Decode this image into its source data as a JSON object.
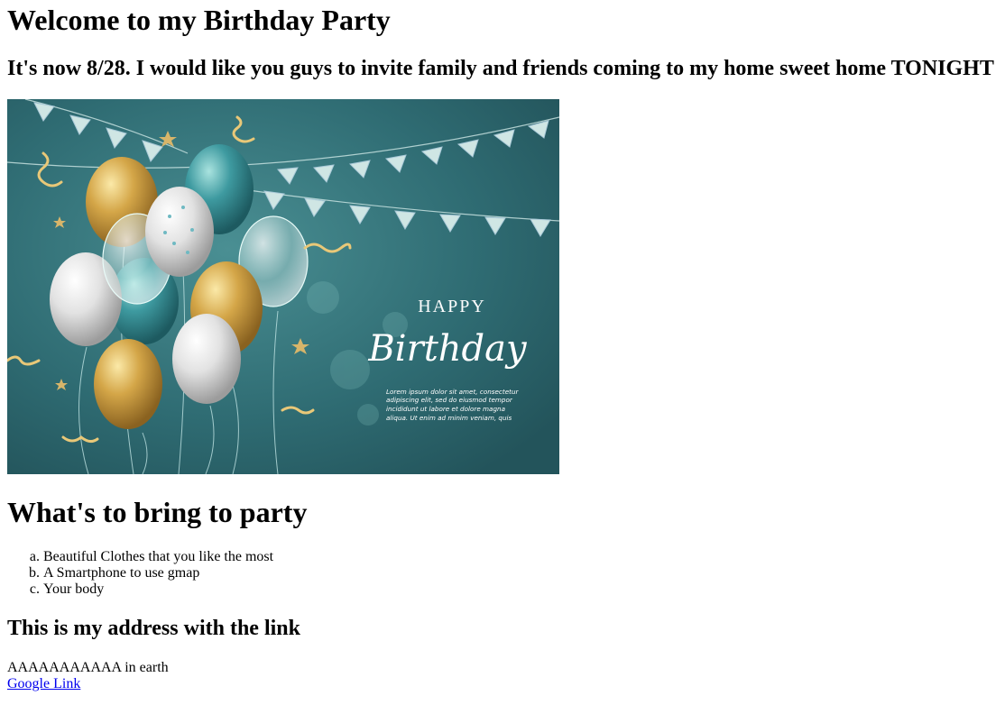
{
  "page": {
    "title": "Welcome to my Birthday Party",
    "subtitle": "It's now 8/28. I would like you guys to invite family and friends coming to my home sweet home TONIGHT"
  },
  "banner": {
    "happy": "HAPPY",
    "birthday": "Birthday",
    "body_line1": "Lorem ipsum dolor sit amet, consectetur",
    "body_line2": "adipiscing elit, sed do eiusmod tempor",
    "body_line3": "incididunt ut labore et dolore magna",
    "body_line4": "aliqua. Ut enim ad minim veniam, quis",
    "colors": {
      "background": "#2f6c73",
      "gold": "#d4a648",
      "teal": "#3e9aa0",
      "silver": "#e2e2e2"
    }
  },
  "bring": {
    "heading": "What's to bring to party",
    "items": [
      "Beautiful Clothes that you like the most",
      "A Smartphone to use gmap",
      "Your body"
    ]
  },
  "address": {
    "heading": "This is my address with the link",
    "text": "AAAAAAAAAAA in earth",
    "link_label": "Google Link"
  }
}
